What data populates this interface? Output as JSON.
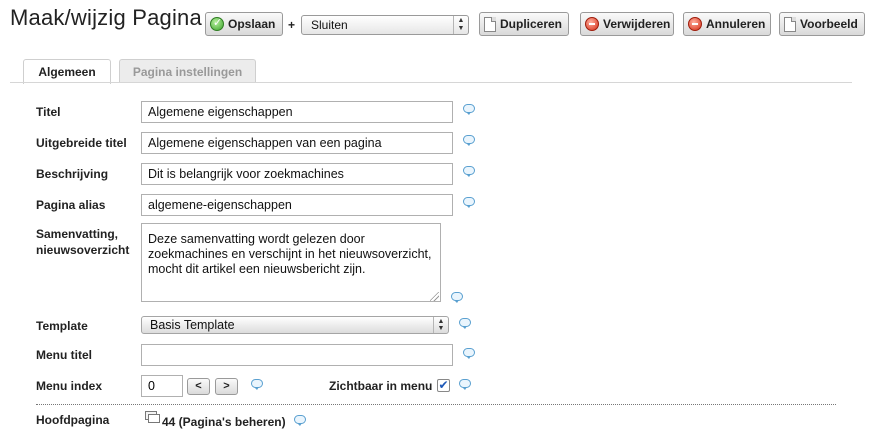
{
  "page": {
    "title": "Maak/wijzig Pagina"
  },
  "toolbar": {
    "save_label": "Opslaan",
    "plus": "+",
    "close_select_value": "Sluiten",
    "duplicate_label": "Dupliceren",
    "delete_label": "Verwijderen",
    "cancel_label": "Annuleren",
    "preview_label": "Voorbeeld"
  },
  "tabs": [
    {
      "label": "Algemeen",
      "active": true
    },
    {
      "label": "Pagina instellingen",
      "active": false
    }
  ],
  "form": {
    "title": {
      "label": "Titel",
      "value": "Algemene eigenschappen"
    },
    "extended_title": {
      "label": "Uitgebreide titel",
      "value": "Algemene eigenschappen van een pagina"
    },
    "description": {
      "label": "Beschrijving",
      "value": "Dit is belangrijk voor zoekmachines"
    },
    "alias": {
      "label": "Pagina alias",
      "value": "algemene-eigenschappen"
    },
    "summary": {
      "label_line1": "Samenvatting,",
      "label_line2": "nieuwsoverzicht",
      "value": "Deze samenvatting wordt gelezen door zoekmachines en verschijnt in het nieuwsoverzicht, mocht dit artikel een nieuwsbericht zijn."
    },
    "template": {
      "label": "Template",
      "value": "Basis Template"
    },
    "menu_title": {
      "label": "Menu titel",
      "value": ""
    },
    "menu_index": {
      "label": "Menu index",
      "value": "0",
      "prev": "<",
      "next": ">"
    },
    "visible_in_menu": {
      "label": "Zichtbaar in menu",
      "checked": true,
      "check_glyph": "✔"
    },
    "parent_page": {
      "label": "Hoofdpagina",
      "value": "44 (Pagina's beheren)"
    }
  },
  "colors": {
    "accent_blue": "#5aa0d0",
    "save_green": "#3ba42a",
    "delete_red": "#d52a12",
    "checkbox_blue": "#1d58b8"
  },
  "icons": {
    "save": "check-circle-icon",
    "delete": "minus-circle-icon",
    "cancel": "red-circle-icon",
    "duplicate": "document-icon",
    "preview": "document-icon",
    "help": "speech-bubble-icon",
    "parent": "windows-icon"
  }
}
